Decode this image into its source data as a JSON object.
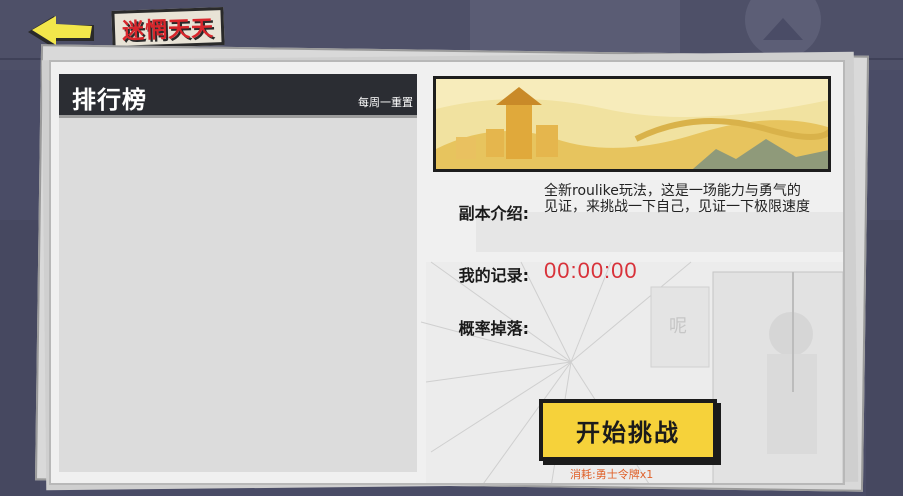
{
  "header": {
    "title": "迷惘天天",
    "back_icon": "back-arrow-icon"
  },
  "leaderboard": {
    "title": "排行榜",
    "reset_note": "每周一重置",
    "entries": []
  },
  "dungeon": {
    "intro_label": "副本介绍:",
    "intro_text": "全新roulike玩法，这是一场能力与勇气的见证，来挑战一下自己，见证一下极限速度",
    "record_label": "我的记录:",
    "record_value": "00:00:00",
    "drop_label": "概率掉落:",
    "drops": []
  },
  "action": {
    "start_label": "开始挑战",
    "cost_text": "消耗:勇士令牌x1"
  },
  "colors": {
    "accent_yellow": "#f6d23a",
    "record_red": "#d8323a",
    "cost_orange": "#e0622a",
    "header_dark": "#2b2d33"
  }
}
